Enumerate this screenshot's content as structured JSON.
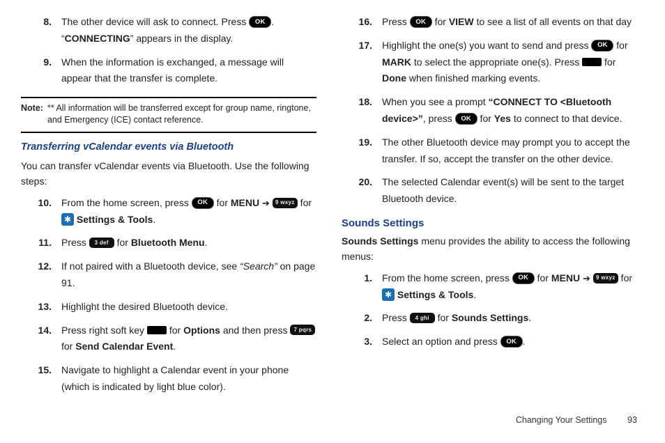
{
  "footer": {
    "section": "Changing Your Settings",
    "page": "93"
  },
  "left": {
    "group1": [
      {
        "n": "8.",
        "fragments": [
          {
            "t": "The other device will ask to connect. Press "
          },
          {
            "icon": "ok"
          },
          {
            "t": ". “"
          },
          {
            "t": "CONNECTING",
            "cls": "bold"
          },
          {
            "t": "” appears in the display."
          }
        ]
      },
      {
        "n": "9.",
        "fragments": [
          {
            "t": "When the information is exchanged, a message will appear that the transfer is complete."
          }
        ]
      }
    ],
    "note": {
      "label": "Note:",
      "text": "** All information will be transferred except for group name, ringtone, and Emergency (ICE) contact reference."
    },
    "subhead": "Transferring vCalendar events via Bluetooth",
    "lead": "You can transfer vCalendar events via Bluetooth. Use the following steps:",
    "group2": [
      {
        "n": "10.",
        "fragments": [
          {
            "t": "From the home screen, press "
          },
          {
            "icon": "ok"
          },
          {
            "t": " for "
          },
          {
            "t": "MENU",
            "cls": "bold"
          },
          {
            "t": "  "
          },
          {
            "t": "➔",
            "cls": "arrow"
          },
          {
            "t": " "
          },
          {
            "icon": "key",
            "label": "9 wxyz"
          },
          {
            "t": " for "
          },
          {
            "icon": "gear"
          },
          {
            "t": " "
          },
          {
            "t": "Settings & Tools",
            "cls": "bold"
          },
          {
            "t": "."
          }
        ]
      },
      {
        "n": "11.",
        "fragments": [
          {
            "t": "Press "
          },
          {
            "icon": "key",
            "label": "3 def"
          },
          {
            "t": " for "
          },
          {
            "t": "Bluetooth Menu",
            "cls": "bold"
          },
          {
            "t": "."
          }
        ]
      },
      {
        "n": "12.",
        "fragments": [
          {
            "t": "If not paired with a Bluetooth device, see "
          },
          {
            "t": "“Search”",
            "cls": "italic"
          },
          {
            "t": " on page 91."
          }
        ]
      },
      {
        "n": "13.",
        "fragments": [
          {
            "t": "Highlight the desired Bluetooth device."
          }
        ]
      },
      {
        "n": "14.",
        "fragments": [
          {
            "t": "Press right soft key "
          },
          {
            "icon": "softkey"
          },
          {
            "t": " for "
          },
          {
            "t": "Options",
            "cls": "bold"
          },
          {
            "t": " and then press "
          },
          {
            "icon": "key",
            "label": "7 pqrs"
          },
          {
            "t": " for "
          },
          {
            "t": "Send Calendar Event",
            "cls": "bold"
          },
          {
            "t": "."
          }
        ]
      },
      {
        "n": "15.",
        "fragments": [
          {
            "t": "Navigate to highlight a Calendar event in your phone (which is indicated by light blue color)."
          }
        ]
      }
    ]
  },
  "right": {
    "group1": [
      {
        "n": "16.",
        "fragments": [
          {
            "t": "Press "
          },
          {
            "icon": "ok"
          },
          {
            "t": " for "
          },
          {
            "t": "VIEW",
            "cls": "bold"
          },
          {
            "t": " to see a list of all events on that day"
          }
        ]
      },
      {
        "n": "17.",
        "fragments": [
          {
            "t": "Highlight the one(s) you want to send and press "
          },
          {
            "icon": "ok"
          },
          {
            "t": " for "
          },
          {
            "t": "MARK",
            "cls": "bold"
          },
          {
            "t": " to select the appropriate one(s). Press "
          },
          {
            "icon": "softkey"
          },
          {
            "t": " for "
          },
          {
            "t": "Done",
            "cls": "bold"
          },
          {
            "t": " when finished marking events."
          }
        ]
      },
      {
        "n": "18.",
        "fragments": [
          {
            "t": "When you see a prompt "
          },
          {
            "t": "“CONNECT TO <Bluetooth device>”",
            "cls": "bold"
          },
          {
            "t": ", press "
          },
          {
            "icon": "ok"
          },
          {
            "t": " for "
          },
          {
            "t": "Yes",
            "cls": "bold"
          },
          {
            "t": " to connect to that device."
          }
        ]
      },
      {
        "n": "19.",
        "fragments": [
          {
            "t": "The other Bluetooth device may prompt you to accept the transfer. If so, accept the transfer on the other device."
          }
        ]
      },
      {
        "n": "20.",
        "fragments": [
          {
            "t": "The selected Calendar event(s) will be sent to the target Bluetooth device."
          }
        ]
      }
    ],
    "heading": "Sounds Settings",
    "para_fragments": [
      {
        "t": "Sounds Settings",
        "cls": "bold"
      },
      {
        "t": " menu provides the ability to access the following menus:"
      }
    ],
    "group2": [
      {
        "n": "1.",
        "fragments": [
          {
            "t": "From the home screen, press "
          },
          {
            "icon": "ok"
          },
          {
            "t": " for "
          },
          {
            "t": "MENU",
            "cls": "bold"
          },
          {
            "t": "  "
          },
          {
            "t": "➔",
            "cls": "arrow"
          },
          {
            "t": " "
          },
          {
            "icon": "key",
            "label": "9 wxyz"
          },
          {
            "t": " for "
          },
          {
            "icon": "gear"
          },
          {
            "t": " "
          },
          {
            "t": "Settings & Tools",
            "cls": "bold"
          },
          {
            "t": "."
          }
        ]
      },
      {
        "n": "2.",
        "fragments": [
          {
            "t": "Press "
          },
          {
            "icon": "key",
            "label": "4 ghi"
          },
          {
            "t": " for "
          },
          {
            "t": "Sounds Settings",
            "cls": "bold"
          },
          {
            "t": "."
          }
        ]
      },
      {
        "n": "3.",
        "fragments": [
          {
            "t": "Select an option and press "
          },
          {
            "icon": "ok"
          },
          {
            "t": "."
          }
        ]
      }
    ]
  }
}
